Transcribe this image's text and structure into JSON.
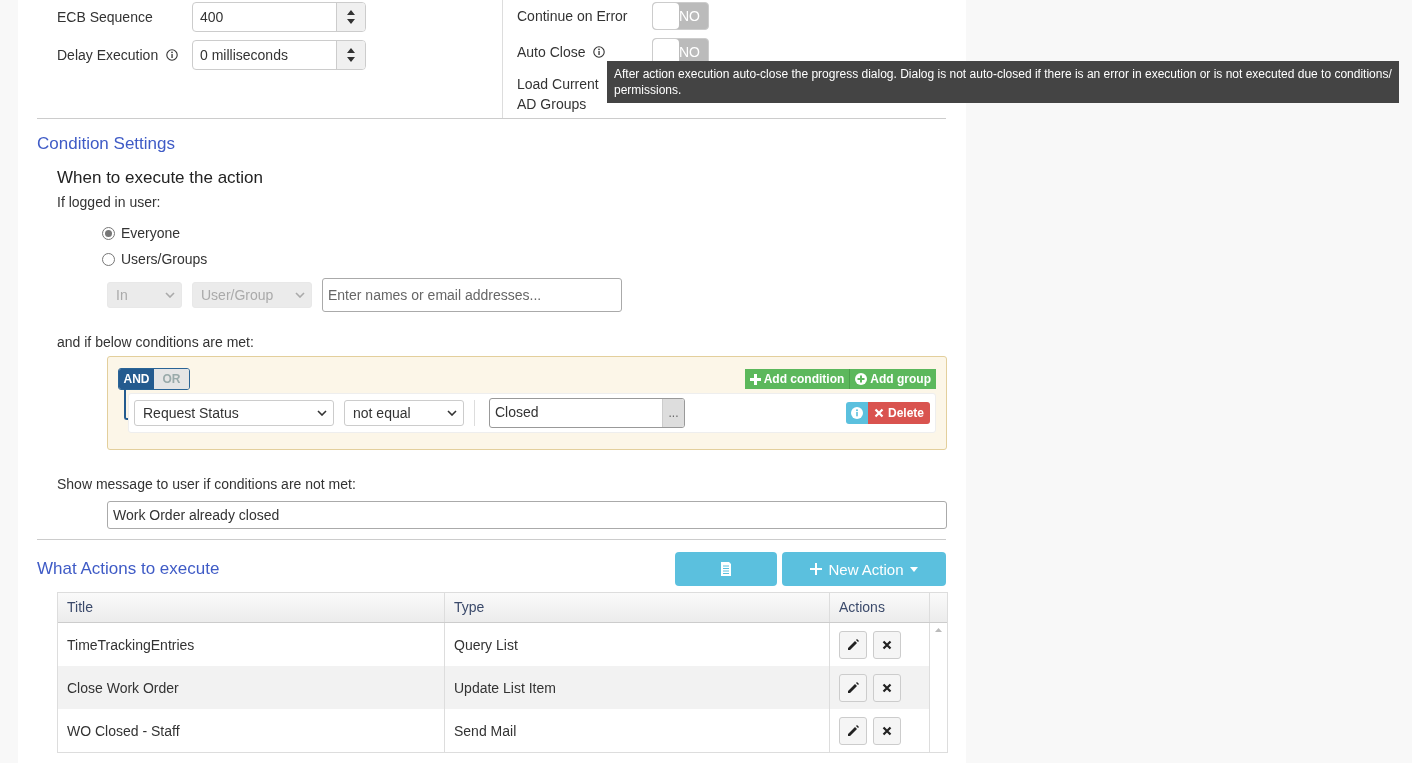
{
  "general_settings": {
    "left": [
      {
        "label": "ECB Sequence",
        "info": false,
        "value": "400"
      },
      {
        "label": "Delay Execution",
        "info": true,
        "value": "0 milliseconds"
      }
    ],
    "right": [
      {
        "label": "Continue on Error",
        "info": false,
        "on": false,
        "toggle_text": "NO"
      },
      {
        "label": "Auto Close",
        "info": true,
        "on": false,
        "toggle_text": "NO"
      },
      {
        "label": "Load Current\nAD Groups",
        "info": false
      }
    ]
  },
  "tooltip": "After action execution auto-close the progress dialog. Dialog is not auto-closed if there is an error in execution or is not executed due to conditions/ permissions.",
  "condition_settings": {
    "title": "Condition Settings",
    "subtitle": "When to execute the action",
    "user_label": "If logged in user:",
    "user_options": [
      {
        "label": "Everyone",
        "selected": true
      },
      {
        "label": "Users/Groups",
        "selected": false
      }
    ],
    "in_select": "In",
    "type_select": "User/Group",
    "people_placeholder": "Enter names or email addresses...",
    "conditions_label": "and if below conditions are met:",
    "logic": [
      {
        "label": "AND",
        "selected": true
      },
      {
        "label": "OR",
        "selected": false
      }
    ],
    "add_condition": "Add condition",
    "add_group": "Add group",
    "rule": {
      "field": "Request Status",
      "operator": "not equal",
      "value": "Closed",
      "more": "...",
      "delete": "Delete"
    },
    "message_label": "Show message to user if conditions are not met:",
    "message": "Work Order already closed"
  },
  "actions": {
    "title": "What Actions to execute",
    "new_action": "New Action",
    "columns": [
      "Title",
      "Type",
      "Actions"
    ],
    "rows": [
      {
        "title": "TimeTrackingEntries",
        "type": "Query List"
      },
      {
        "title": "Close Work Order",
        "type": "Update List Item"
      },
      {
        "title": "WO Closed - Staff",
        "type": "Send Mail"
      }
    ]
  }
}
